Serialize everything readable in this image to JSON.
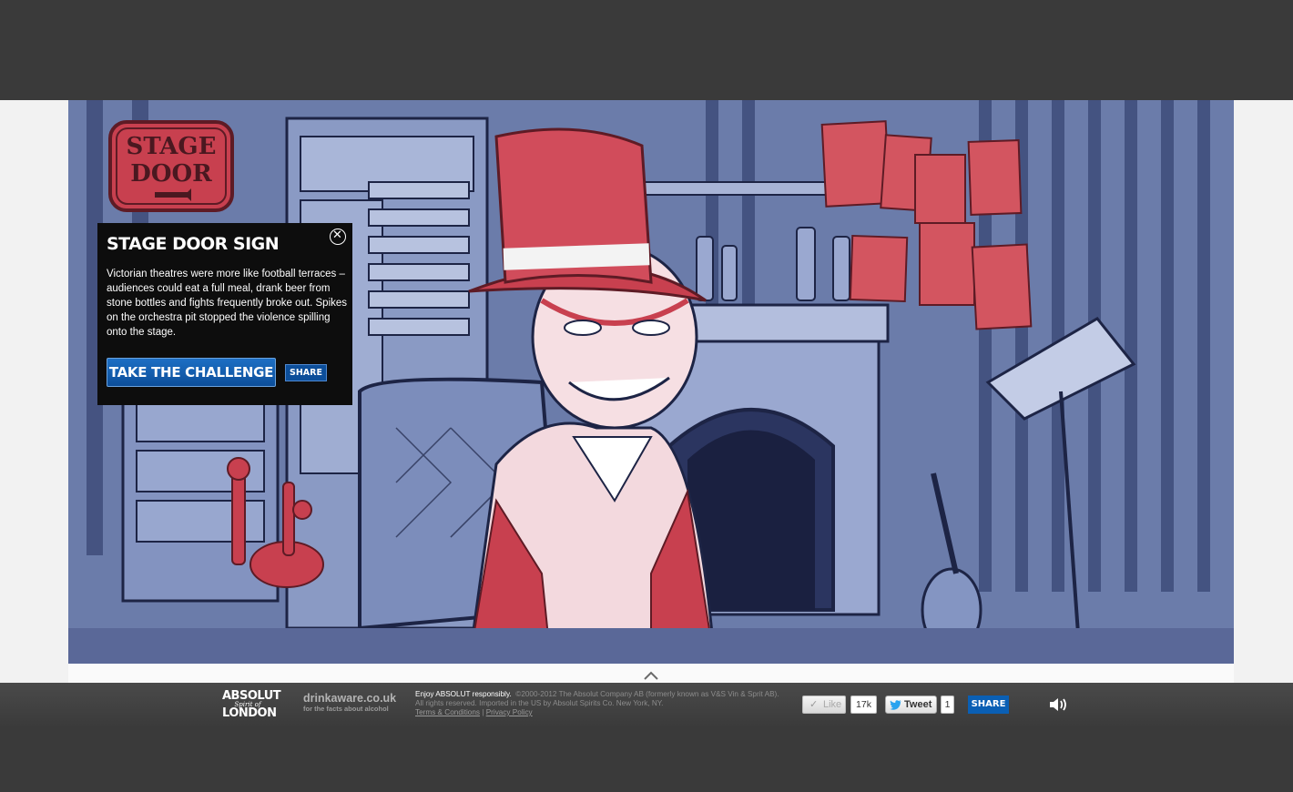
{
  "colors": {
    "page_bg": "#3a3a3a",
    "scene_blue": "#5d6e9e",
    "accent_red": "#c8404f",
    "popup_bg": "#0d0d0d",
    "button_blue": "#0c4e9a"
  },
  "scene": {
    "sign": {
      "line1": "STAGE",
      "line2": "DOOR"
    }
  },
  "popup": {
    "title": "STAGE DOOR SIGN",
    "close_icon": "close-circle-icon",
    "body": "Victorian theatres were more like football terraces – audiences could eat a full meal, drank beer from stone bottles and fights frequently broke out. Spikes on the orchestra pit stopped the violence spilling onto the stage.",
    "challenge_label": "TAKE THE CHALLENGE",
    "share_label": "SHARE"
  },
  "footer": {
    "logo": {
      "line1": "ABSOLUT",
      "line2": "Spirit of",
      "line3": "LONDON"
    },
    "drinkaware": {
      "name": "drinkaware.co.uk",
      "tagline": "for the facts about alcohol"
    },
    "legal": {
      "lead": "Enjoy ABSOLUT responsibly.",
      "text": "©2000-2012 The Absolut Company AB (formerly known as V&S Vin & Sprit AB). All rights reserved. Imported in the US by Absolut Spirits Co. New York, NY.",
      "terms": "Terms & Conditions",
      "separator": "|",
      "privacy": "Privacy Policy"
    },
    "like_label": "Like",
    "like_count": "17k",
    "tweet_label": "Tweet",
    "tweet_count": "1",
    "share_label": "SHARE",
    "sound_icon": "speaker-icon"
  }
}
